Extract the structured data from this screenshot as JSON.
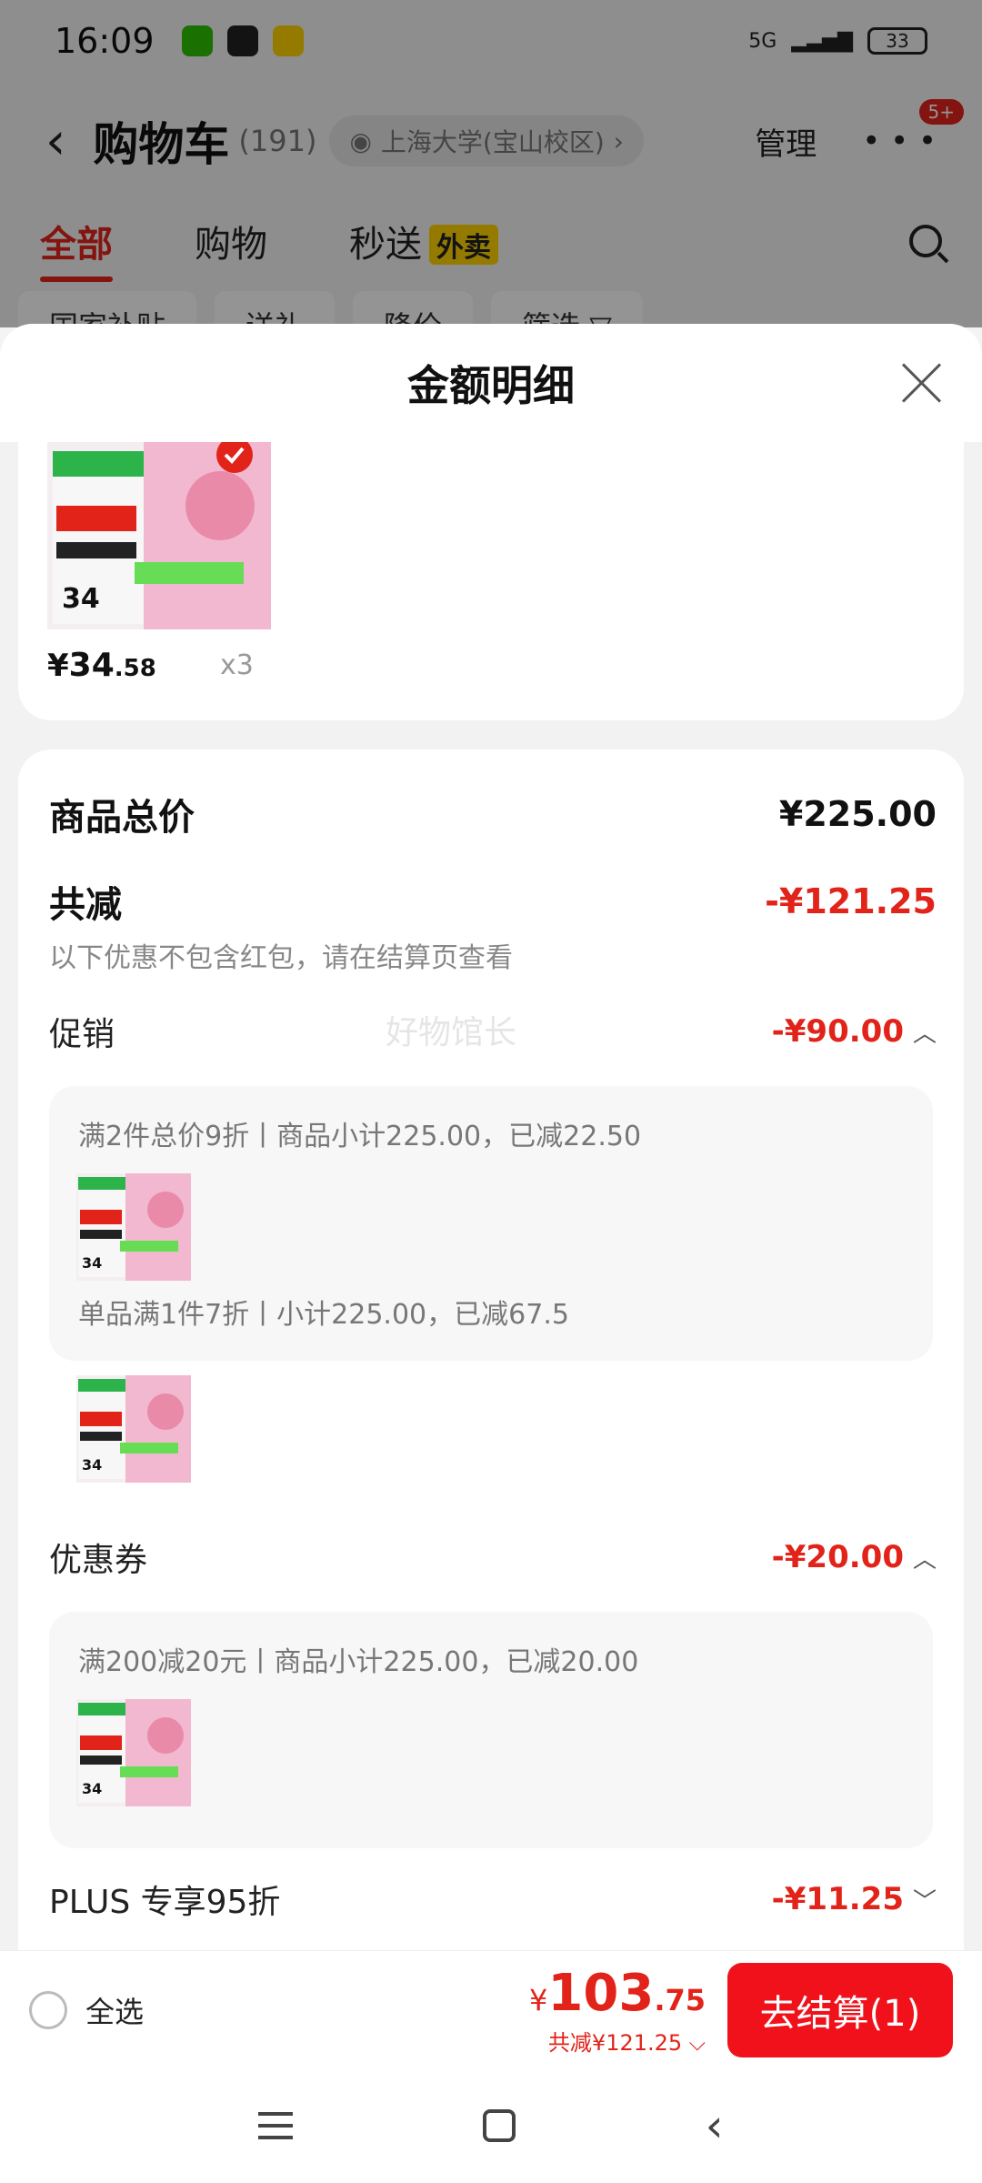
{
  "status_bar": {
    "time": "16:09",
    "signal": "5G",
    "battery": "33"
  },
  "header": {
    "title": "购物车",
    "count": "(191)",
    "location": "上海大学(宝山校区)",
    "location_chevron": "›",
    "manage": "管理",
    "more_badge": "5+"
  },
  "tabs": [
    {
      "label": "全部"
    },
    {
      "label": "购物"
    },
    {
      "label": "秒送",
      "tag": "外卖"
    }
  ],
  "chips": [
    "国家补贴",
    "送礼",
    "降价",
    "筛选 ▽"
  ],
  "sheet": {
    "title": "金额明细"
  },
  "product": {
    "price_yen": "¥",
    "price_int": "34",
    "price_dec": ".58",
    "qty": "x3"
  },
  "summary": {
    "goods_total_label": "商品总价",
    "goods_total_value": "¥225.00",
    "discount_label": "共减",
    "discount_value": "-¥121.25",
    "note": "以下优惠不包含红包，请在结算页查看",
    "promo_label": "促销",
    "promo_value": "-¥90.00",
    "promo_lines": [
      "满2件总价9折丨商品小计225.00，已减22.50",
      "单品满1件7折丨小计225.00，已减67.5"
    ],
    "coupon_label": "优惠券",
    "coupon_value": "-¥20.00",
    "coupon_lines": [
      "满200减20元丨商品小计225.00，已减20.00"
    ],
    "plus_label": "PLUS 专享95折",
    "plus_value": "-¥11.25",
    "watermark": "好物馆长"
  },
  "bottom": {
    "select_all": "全选",
    "total_yen": "¥",
    "total_int": "103",
    "total_dec": ".75",
    "total_sub": "共减¥121.25 ⌵",
    "checkout": "去结算(1)"
  },
  "colors": {
    "brand_red": "#e2231a",
    "checkout_red": "#f0111b",
    "tag_yellow": "#ffd400"
  }
}
